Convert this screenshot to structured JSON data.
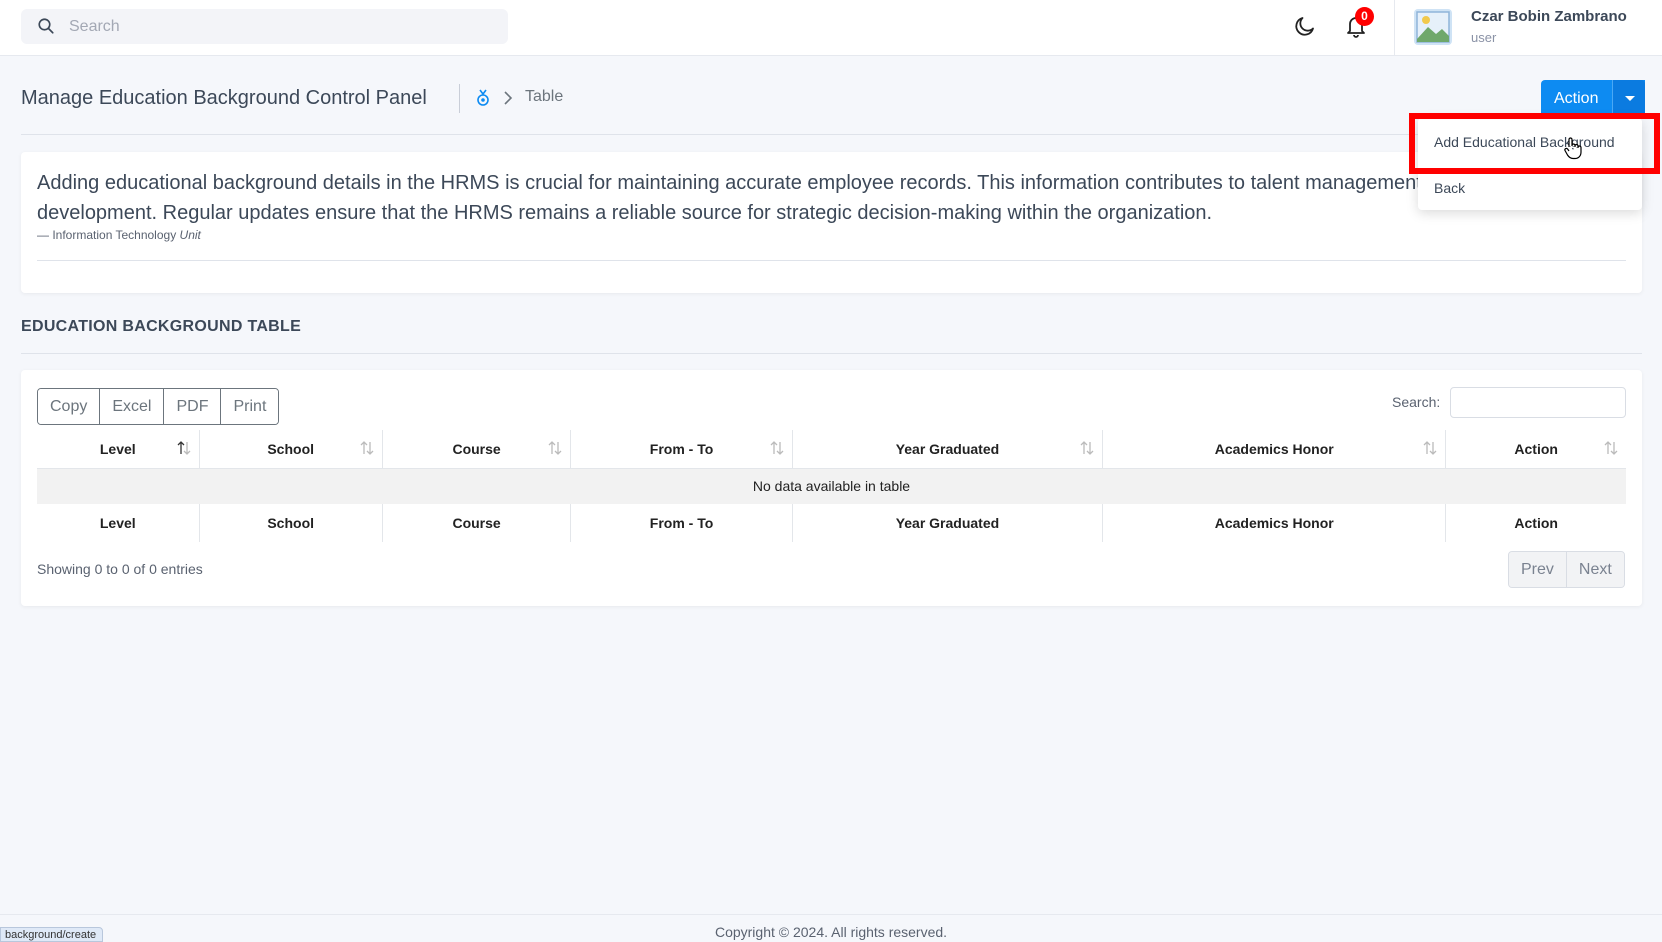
{
  "topbar": {
    "search_placeholder": "Search",
    "notification_count": "0",
    "user_name": "Czar Bobin Zambrano",
    "user_role": "user"
  },
  "header": {
    "title": "Manage Education Background Control Panel",
    "breadcrumb_current": "Table",
    "action_label": "Action"
  },
  "dropdown": {
    "items": [
      {
        "label": "Add Educational Background"
      },
      {
        "label": "Back"
      }
    ]
  },
  "quote": {
    "text": "Adding educational background details in the HRMS is crucial for maintaining accurate employee records. This information contributes to talent management, organizational planning, and development. Regular updates ensure that the HRMS remains a reliable source for strategic decision-making within the organization.",
    "footer_source": "Information Technology",
    "footer_emphasis": "Unit"
  },
  "section": {
    "title": "EDUCATION BACKGROUND TABLE"
  },
  "table": {
    "export_buttons": [
      "Copy",
      "Excel",
      "PDF",
      "Print"
    ],
    "search_label": "Search:",
    "columns": [
      "Level",
      "School",
      "Course",
      "From - To",
      "Year Graduated",
      "Academics Honor",
      "Action"
    ],
    "empty_message": "No data available in table",
    "showing": "Showing 0 to 0 of 0 entries",
    "prev_label": "Prev",
    "next_label": "Next"
  },
  "footer": {
    "copyright": "Copyright © 2024. All rights reserved.",
    "status_url": "background/create"
  },
  "colors": {
    "primary": "#0d8bf2",
    "badge": "#ff0000",
    "highlight": "#ff0000"
  }
}
